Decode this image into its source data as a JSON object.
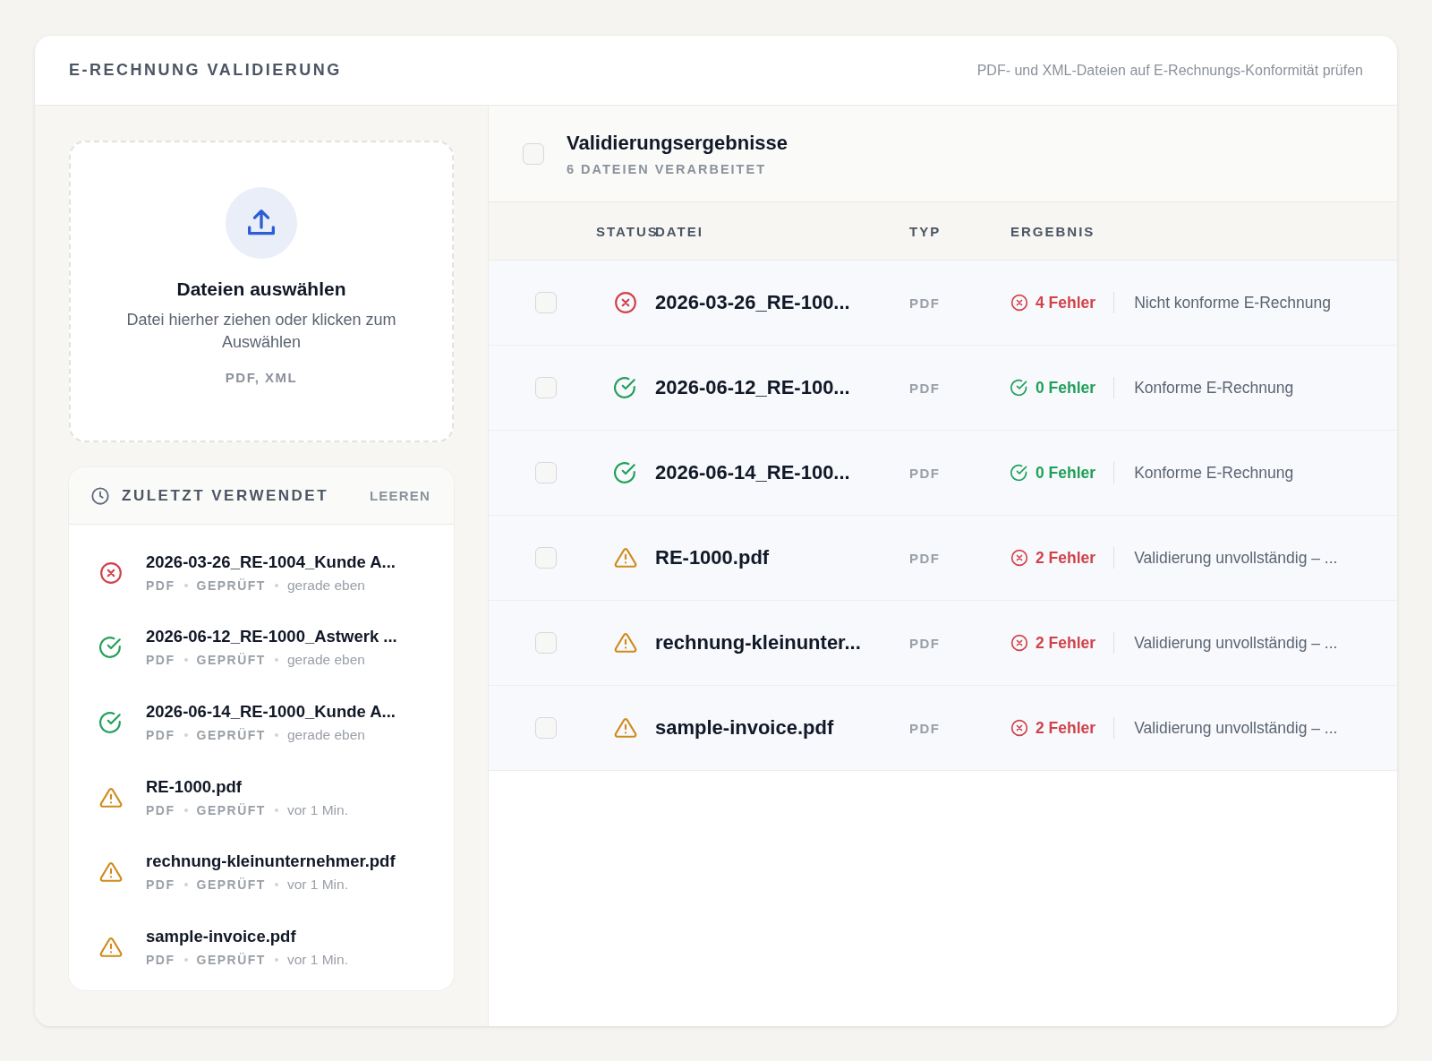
{
  "header": {
    "title": "E-RECHNUNG VALIDIERUNG",
    "subtitle": "PDF- und XML-Dateien auf E-Rechnungs-Konformität prüfen"
  },
  "dropzone": {
    "title": "Dateien auswählen",
    "hint": "Datei hierher ziehen oder klicken zum Auswählen",
    "formats": "PDF, XML"
  },
  "recent": {
    "title": "ZULETZT VERWENDET",
    "clear": "LEEREN",
    "items": [
      {
        "kind": "error",
        "name": "2026-03-26_RE-1004_Kunde A...",
        "type": "PDF",
        "state": "GEPRÜFT",
        "time": "gerade eben"
      },
      {
        "kind": "success",
        "name": "2026-06-12_RE-1000_Astwerk ...",
        "type": "PDF",
        "state": "GEPRÜFT",
        "time": "gerade eben"
      },
      {
        "kind": "success",
        "name": "2026-06-14_RE-1000_Kunde A...",
        "type": "PDF",
        "state": "GEPRÜFT",
        "time": "gerade eben"
      },
      {
        "kind": "warning",
        "name": "RE-1000.pdf",
        "type": "PDF",
        "state": "GEPRÜFT",
        "time": "vor 1 Min."
      },
      {
        "kind": "warning",
        "name": "rechnung-kleinunternehmer.pdf",
        "type": "PDF",
        "state": "GEPRÜFT",
        "time": "vor 1 Min."
      },
      {
        "kind": "warning",
        "name": "sample-invoice.pdf",
        "type": "PDF",
        "state": "GEPRÜFT",
        "time": "vor 1 Min."
      }
    ]
  },
  "results": {
    "title": "Validierungsergebnisse",
    "count": "6 DATEIEN VERARBEITET",
    "select_all": {
      "checked": false
    },
    "columns": [
      "STATUS",
      "DATEI",
      "TYP",
      "ERGEBNIS"
    ],
    "rows": [
      {
        "checked": false,
        "kind": "error",
        "file": "2026-03-26_RE-100...",
        "type": "PDF",
        "result": {
          "kind": "error",
          "text": "4 Fehler"
        },
        "message": "Nicht konforme E-Rechnung"
      },
      {
        "checked": false,
        "kind": "success",
        "file": "2026-06-12_RE-100...",
        "type": "PDF",
        "result": {
          "kind": "success",
          "text": "0 Fehler"
        },
        "message": "Konforme E-Rechnung"
      },
      {
        "checked": false,
        "kind": "success",
        "file": "2026-06-14_RE-100...",
        "type": "PDF",
        "result": {
          "kind": "success",
          "text": "0 Fehler"
        },
        "message": "Konforme E-Rechnung"
      },
      {
        "checked": false,
        "kind": "warning",
        "file": "RE-1000.pdf",
        "type": "PDF",
        "result": {
          "kind": "error",
          "text": "2 Fehler"
        },
        "message": "Validierung unvollständig – ..."
      },
      {
        "checked": false,
        "kind": "warning",
        "file": "rechnung-kleinunter...",
        "type": "PDF",
        "result": {
          "kind": "error",
          "text": "2 Fehler"
        },
        "message": "Validierung unvollständig – ..."
      },
      {
        "checked": false,
        "kind": "warning",
        "file": "sample-invoice.pdf",
        "type": "PDF",
        "result": {
          "kind": "error",
          "text": "2 Fehler"
        },
        "message": "Validierung unvollständig – ..."
      }
    ]
  }
}
